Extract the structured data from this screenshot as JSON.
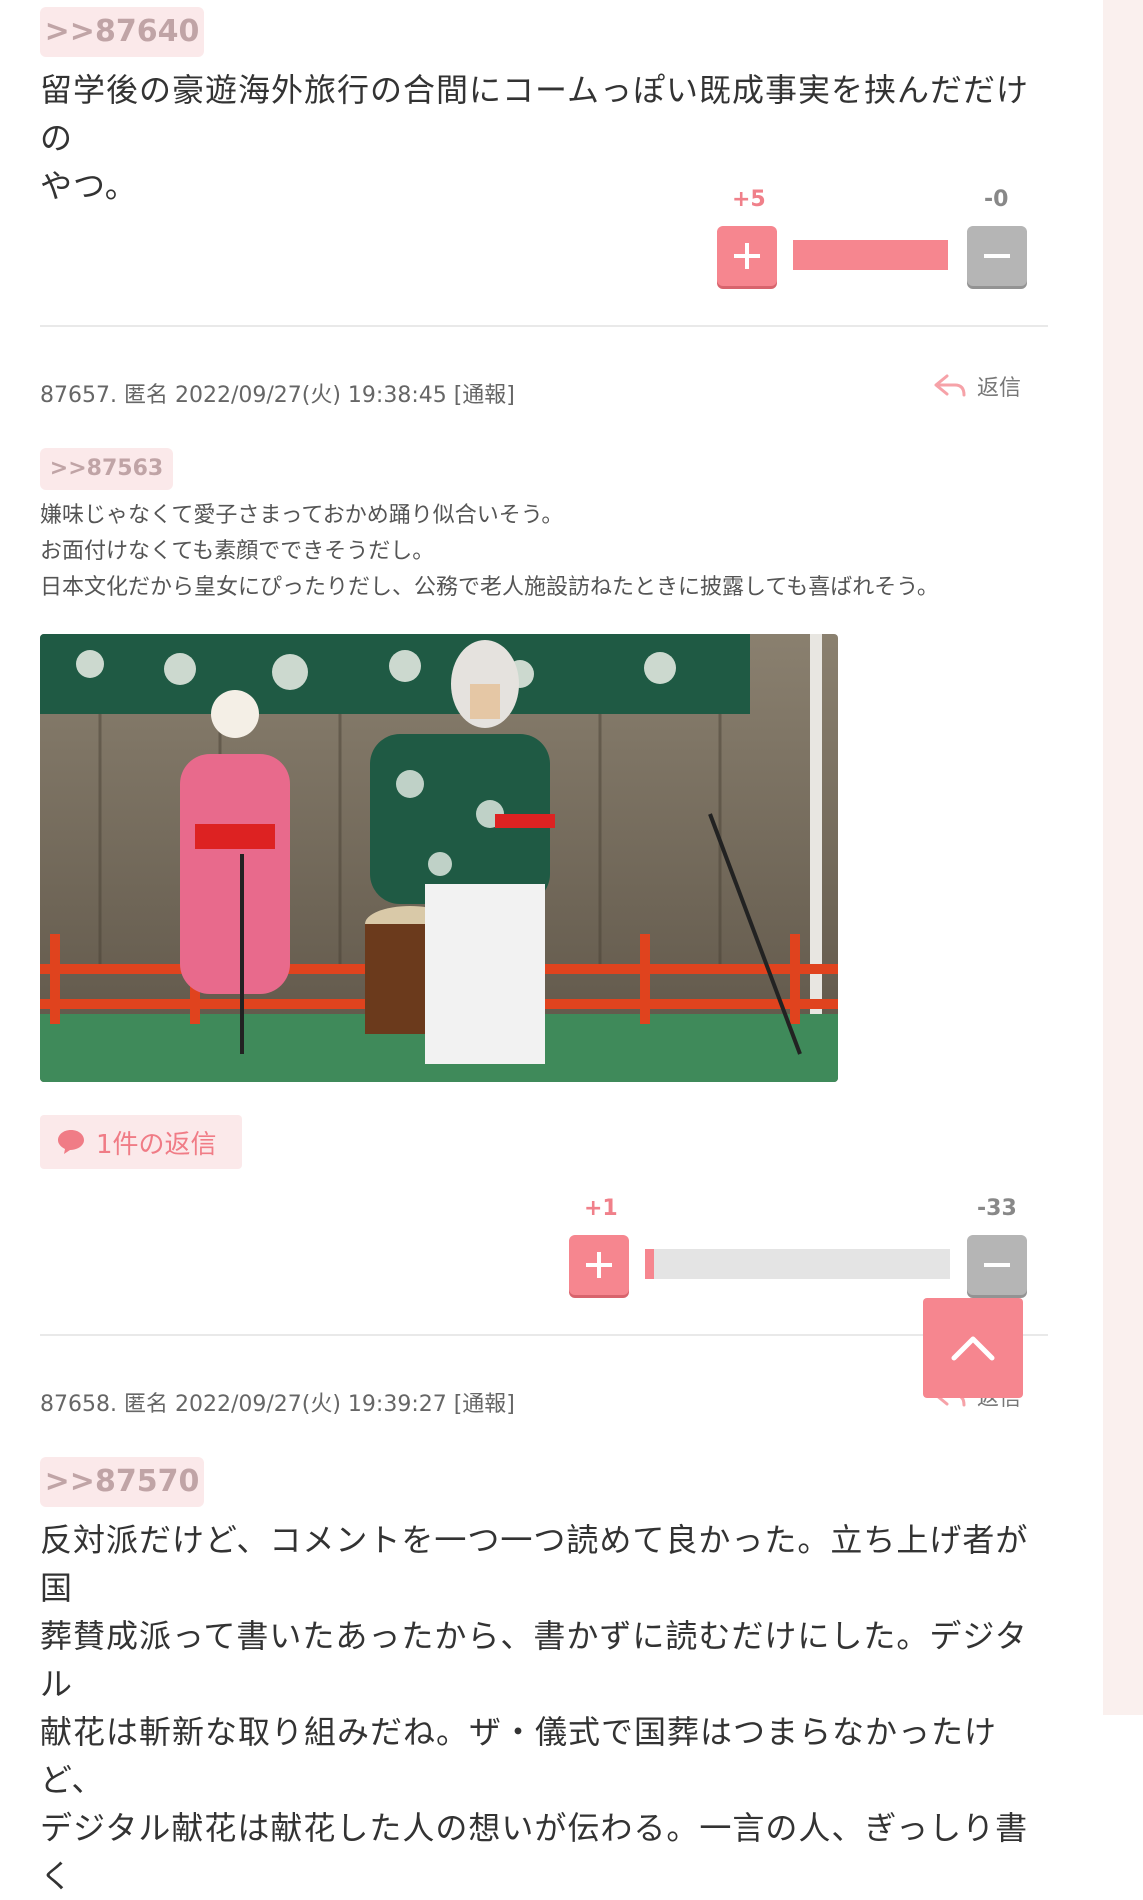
{
  "comment_prev": {
    "anchor": ">>87640",
    "text_lines": [
      "留学後の豪遊海外旅行の合間にコームっぽい既成事実を挟んだだけの",
      "やつ。"
    ],
    "votes": {
      "plus": "+5",
      "minus": "-0",
      "plus_ratio": 1.0
    }
  },
  "comment_87657": {
    "meta": "87657. 匿名 2022/09/27(火) 19:38:45 [通報]",
    "reply_label": "返信",
    "anchor": ">>87563",
    "text_lines": [
      "嫌味じゃなくて愛子さまっておかめ踊り似合いそう。",
      "お面付けなくても素顔でできそうだし。",
      "日本文化だから皇女にぴったりだし、公務で老人施設訪ねたときに披露しても喜ばれそう。"
    ],
    "reply_count": "1件の返信",
    "votes": {
      "plus": "+1",
      "minus": "-33",
      "plus_ratio": 0.03
    }
  },
  "comment_87658": {
    "meta": "87658. 匿名 2022/09/27(火) 19:39:27 [通報]",
    "reply_label": "返信",
    "anchor": ">>87570",
    "text_lines": [
      "反対派だけど、コメントを一つ一つ読めて良かった。立ち上げ者が国",
      "葬賛成派って書いたあったから、書かずに読むだけにした。デジタル",
      "献花は斬新な取り組みだね。ザ・儀式で国葬はつまらなかったけど、",
      "デジタル献花は献花した人の想いが伝わる。一言の人、ぎっしり書く"
    ]
  },
  "colors": {
    "accent": "#f6868f",
    "minus": "#b5b5b5",
    "tag_bg": "#fbe9ea"
  },
  "icons": {
    "reply": "reply-arrow-icon",
    "speech": "speech-bubble-icon",
    "up": "chevron-up-icon"
  }
}
